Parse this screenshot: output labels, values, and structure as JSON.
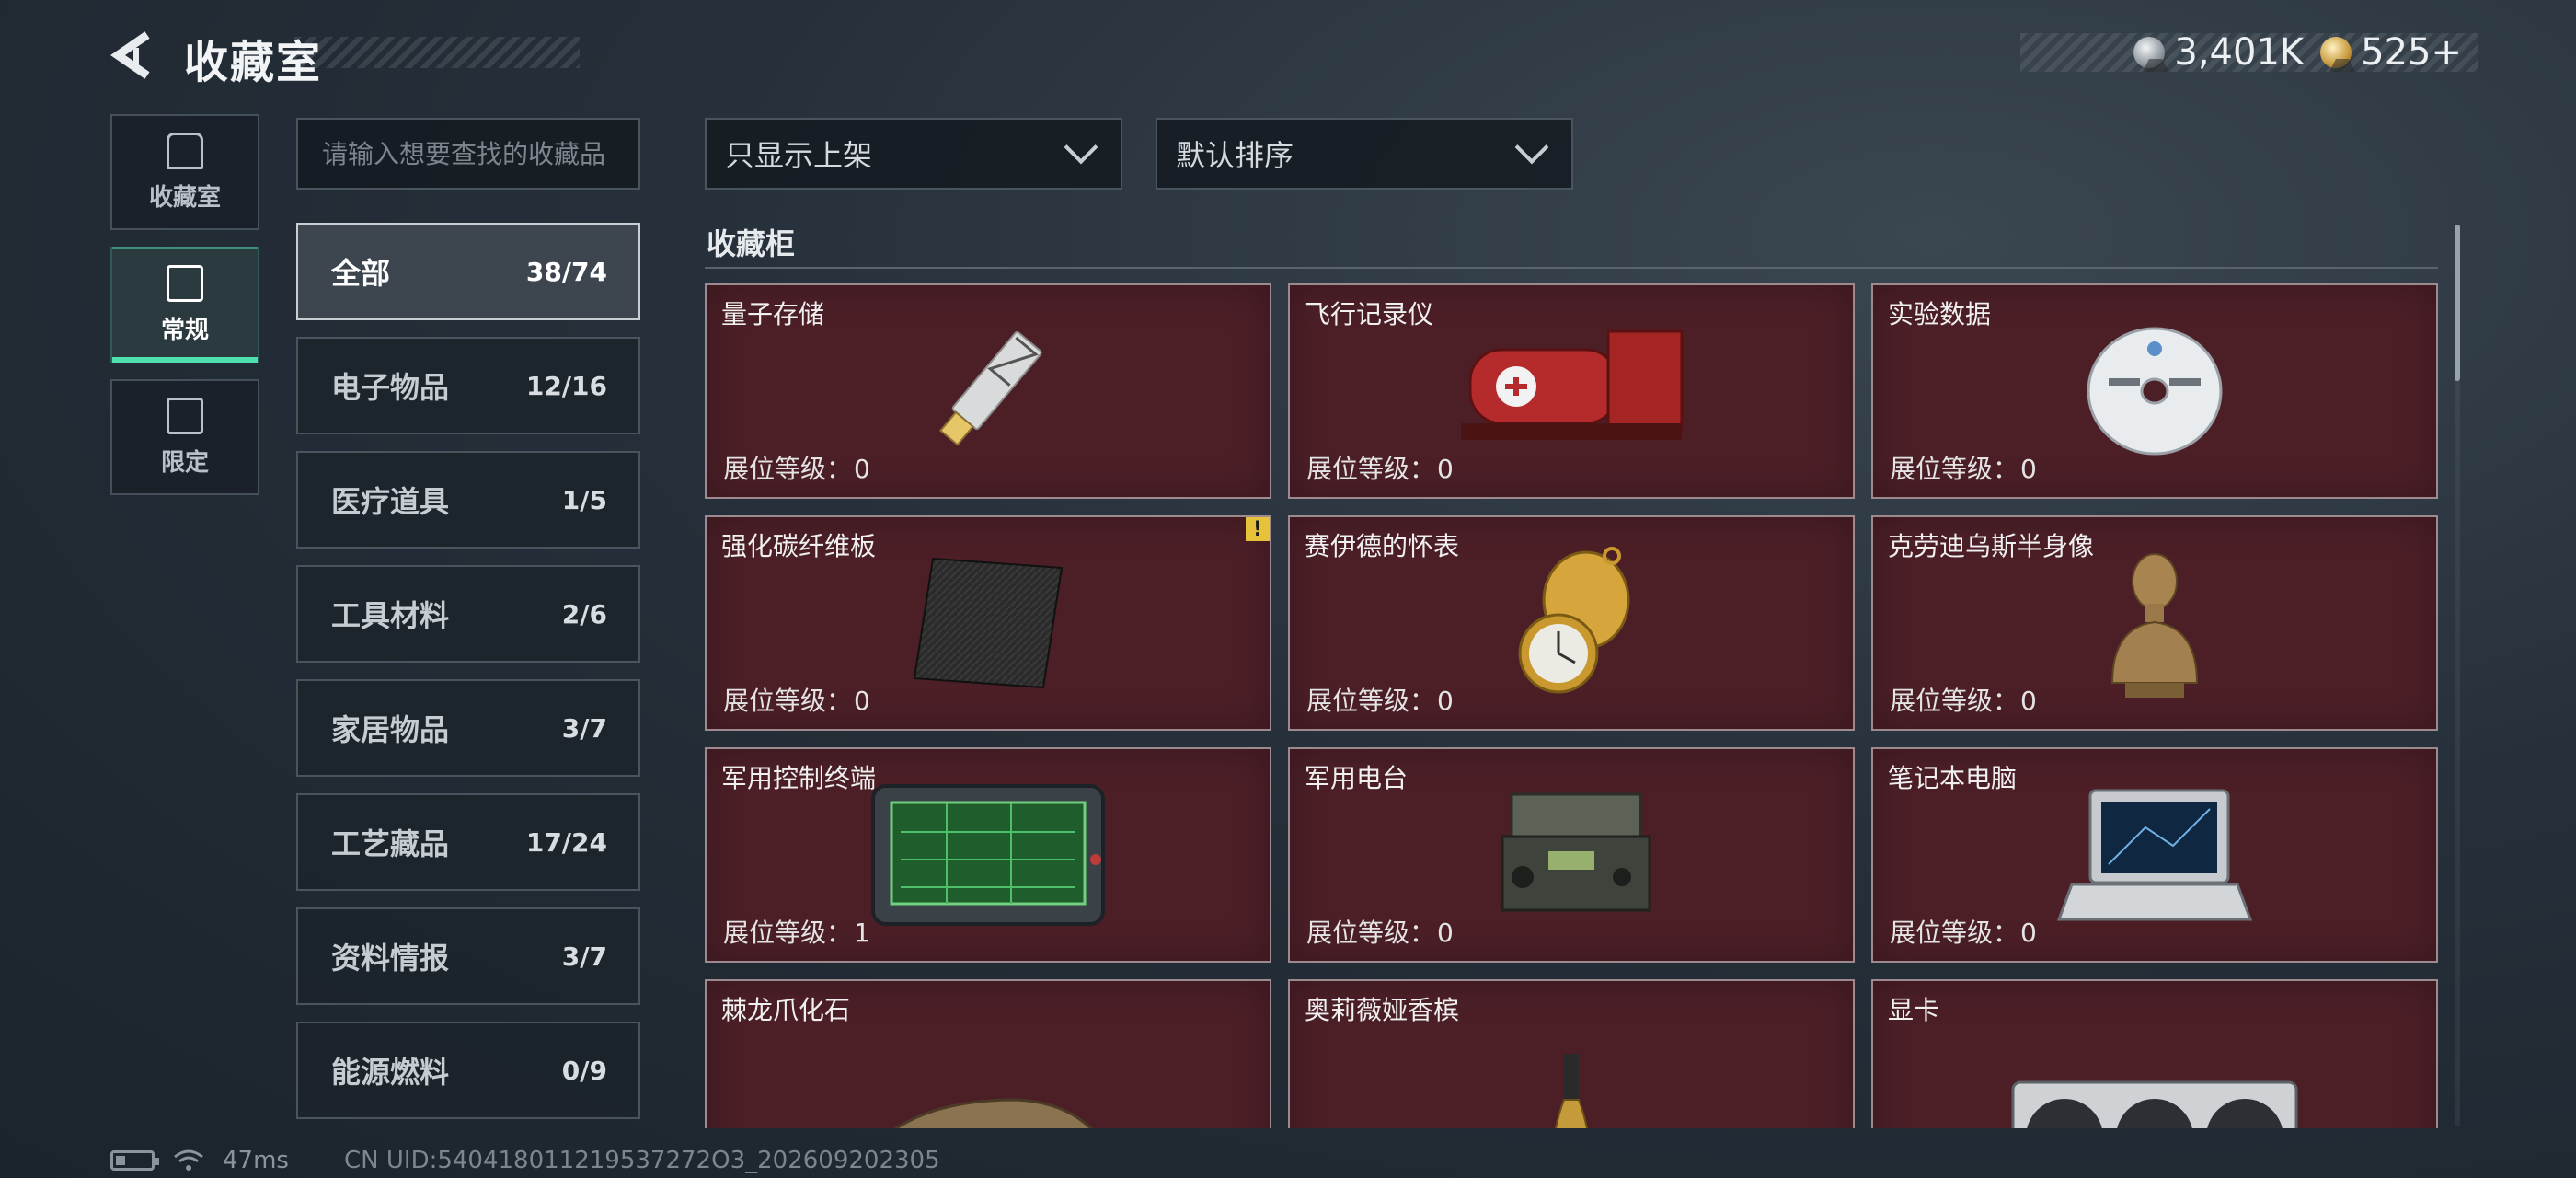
{
  "header": {
    "title": "收藏室",
    "currencies": [
      {
        "icon": "silver-coin-icon",
        "value": "3,401K"
      },
      {
        "icon": "gold-coin-icon",
        "value": "525+"
      }
    ]
  },
  "side_tabs": [
    {
      "label": "收藏室",
      "icon": "collection-room-icon",
      "active": false
    },
    {
      "label": "常规",
      "icon": "regular-icon",
      "active": true
    },
    {
      "label": "限定",
      "icon": "limited-icon",
      "active": false
    }
  ],
  "search": {
    "placeholder": "请输入想要查找的收藏品",
    "value": ""
  },
  "categories": [
    {
      "name": "全部",
      "count": "38/74",
      "active": true
    },
    {
      "name": "电子物品",
      "count": "12/16"
    },
    {
      "name": "医疗道具",
      "count": "1/5"
    },
    {
      "name": "工具材料",
      "count": "2/6"
    },
    {
      "name": "家居物品",
      "count": "3/7"
    },
    {
      "name": "工艺藏品",
      "count": "17/24"
    },
    {
      "name": "资料情报",
      "count": "3/7"
    },
    {
      "name": "能源燃料",
      "count": "0/9"
    }
  ],
  "filters": {
    "display_filter": "只显示上架",
    "sort": "默认排序"
  },
  "cabinet": {
    "title": "收藏柜",
    "level_label": "展位等级：",
    "items": [
      {
        "name": "量子存储",
        "level": "0",
        "icon": "usb-drive-icon"
      },
      {
        "name": "飞行记录仪",
        "level": "0",
        "icon": "flight-recorder-icon"
      },
      {
        "name": "实验数据",
        "level": "0",
        "icon": "disc-icon"
      },
      {
        "name": "强化碳纤维板",
        "level": "0",
        "icon": "carbon-plate-icon",
        "warning": "!"
      },
      {
        "name": "赛伊德的怀表",
        "level": "0",
        "icon": "pocket-watch-icon"
      },
      {
        "name": "克劳迪乌斯半身像",
        "level": "0",
        "icon": "bust-icon"
      },
      {
        "name": "军用控制终端",
        "level": "1",
        "icon": "control-terminal-icon"
      },
      {
        "name": "军用电台",
        "level": "0",
        "icon": "radio-icon"
      },
      {
        "name": "笔记本电脑",
        "level": "0",
        "icon": "laptop-icon"
      },
      {
        "name": "棘龙爪化石",
        "level": "",
        "icon": "claw-fossil-icon"
      },
      {
        "name": "奥莉薇娅香槟",
        "level": "",
        "icon": "champagne-icon"
      },
      {
        "name": "显卡",
        "level": "",
        "icon": "graphics-card-icon"
      }
    ]
  },
  "footer": {
    "ping": "47ms",
    "uid": "CN UID:540418011219537272O3_202609202305"
  },
  "colors": {
    "card_bg": "#4c1f27",
    "accent": "#4fe0b0",
    "warning": "#e5c23a"
  }
}
